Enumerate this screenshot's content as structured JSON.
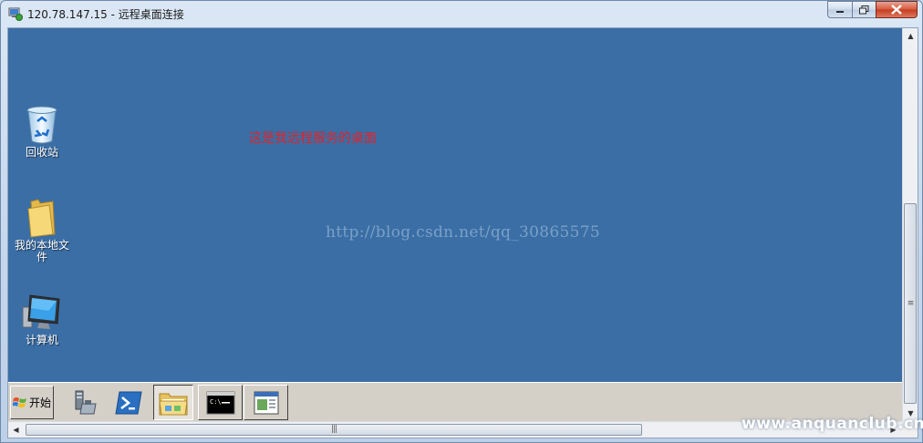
{
  "window": {
    "title": "120.78.147.15 - 远程桌面连接"
  },
  "desktop": {
    "background": "#3a6ea5",
    "icons": [
      {
        "name": "recycle-bin",
        "label": "回收站"
      },
      {
        "name": "my-documents",
        "label": "我的本地文件"
      },
      {
        "name": "computer",
        "label": "计算机"
      }
    ],
    "note": "这是我远程服务的桌面",
    "watermark": "http://blog.csdn.net/qq_30865575"
  },
  "taskbar": {
    "start_label": "开始",
    "items": [
      {
        "icon": "server-manager-icon"
      },
      {
        "icon": "powershell-icon"
      },
      {
        "icon": "windows-explorer-icon"
      },
      {
        "icon": "command-prompt-icon"
      },
      {
        "icon": "application-window-icon"
      }
    ]
  },
  "overlay": {
    "site_mark": "www.anquanclub.cn"
  }
}
